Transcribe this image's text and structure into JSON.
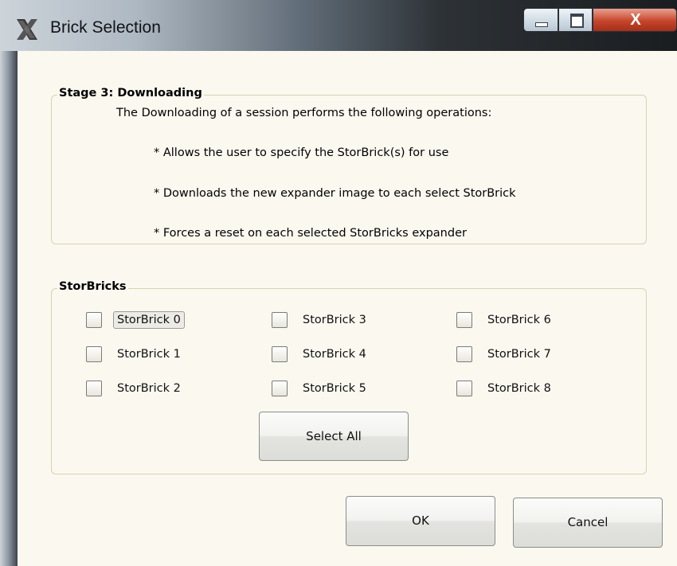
{
  "window": {
    "title": "Brick Selection",
    "app_icon": "x-window-icon",
    "controls": {
      "minimize": "minimize-icon",
      "maximize": "maximize-icon",
      "close_label": "X"
    }
  },
  "stage": {
    "legend": "Stage 3: Downloading",
    "description": "The Downloading of a session performs the following operations:",
    "bullets": [
      "* Allows the user to specify the StorBrick(s) for use",
      "* Downloads the new expander image to each select StorBrick",
      "* Forces a reset on each selected StorBricks expander"
    ]
  },
  "storbricks": {
    "legend": "StorBricks",
    "items": [
      {
        "label": "StorBrick 0",
        "checked": false
      },
      {
        "label": "StorBrick 1",
        "checked": false
      },
      {
        "label": "StorBrick 2",
        "checked": false
      },
      {
        "label": "StorBrick 3",
        "checked": false
      },
      {
        "label": "StorBrick 4",
        "checked": false
      },
      {
        "label": "StorBrick 5",
        "checked": false
      },
      {
        "label": "StorBrick 6",
        "checked": false
      },
      {
        "label": "StorBrick 7",
        "checked": false
      },
      {
        "label": "StorBrick 8",
        "checked": false
      }
    ],
    "select_all_label": "Select All"
  },
  "actions": {
    "ok_label": "OK",
    "cancel_label": "Cancel"
  }
}
